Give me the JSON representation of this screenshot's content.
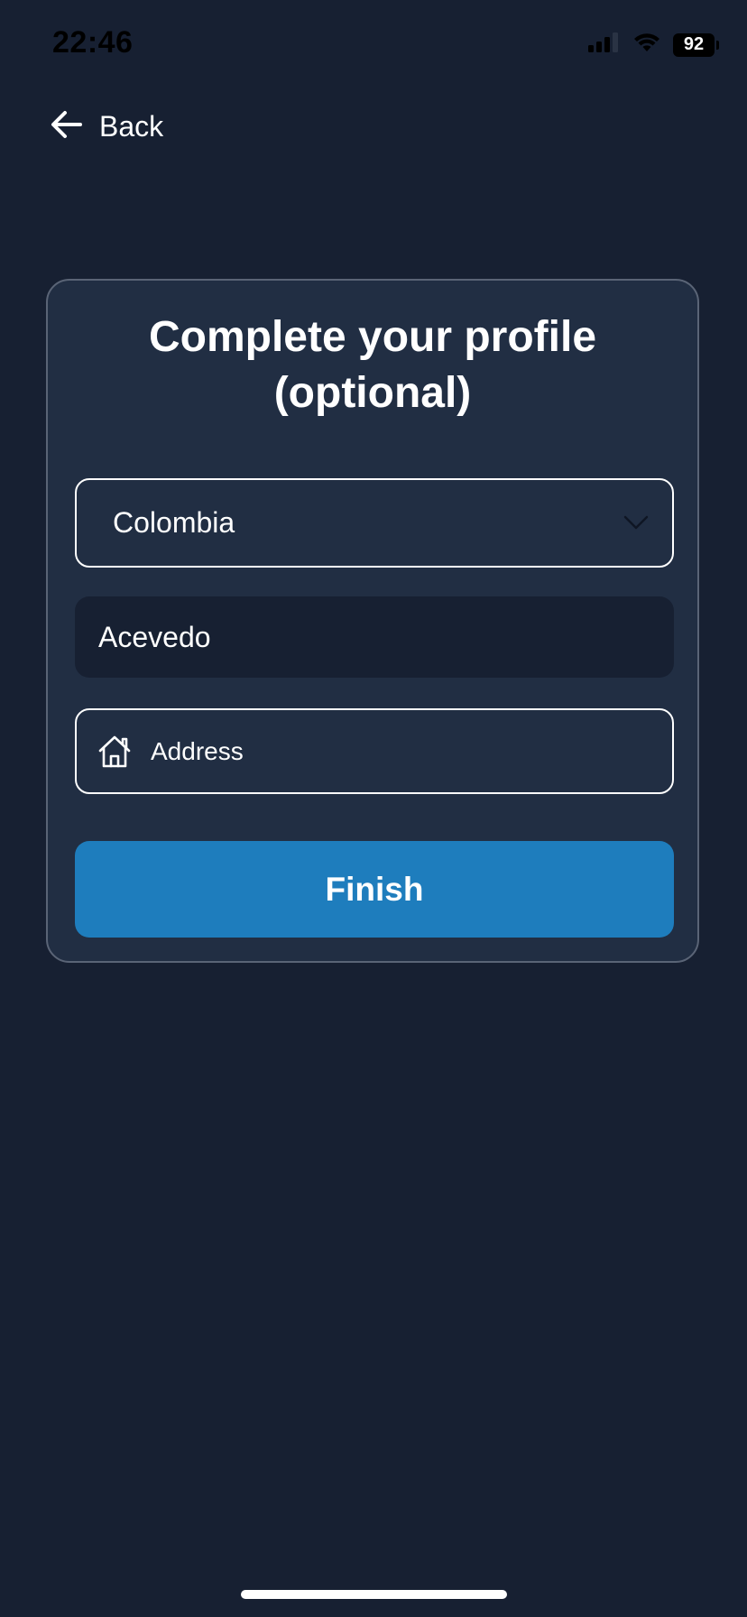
{
  "status_bar": {
    "time": "22:46",
    "battery": "92"
  },
  "nav": {
    "back_label": "Back"
  },
  "card": {
    "title": "Complete your profile (optional)"
  },
  "form": {
    "country_value": "Colombia",
    "surname_value": "Acevedo",
    "address_placeholder": "Address",
    "finish_label": "Finish"
  },
  "icons": {
    "back": "arrow-left-icon",
    "chevron": "chevron-down-icon",
    "address": "home-icon",
    "signal": "signal-icon",
    "wifi": "wifi-icon"
  },
  "colors": {
    "background": "#172032",
    "card": "#212e43",
    "card_border": "#5a6476",
    "primary_button": "#1e7dbd",
    "text": "#ffffff"
  }
}
